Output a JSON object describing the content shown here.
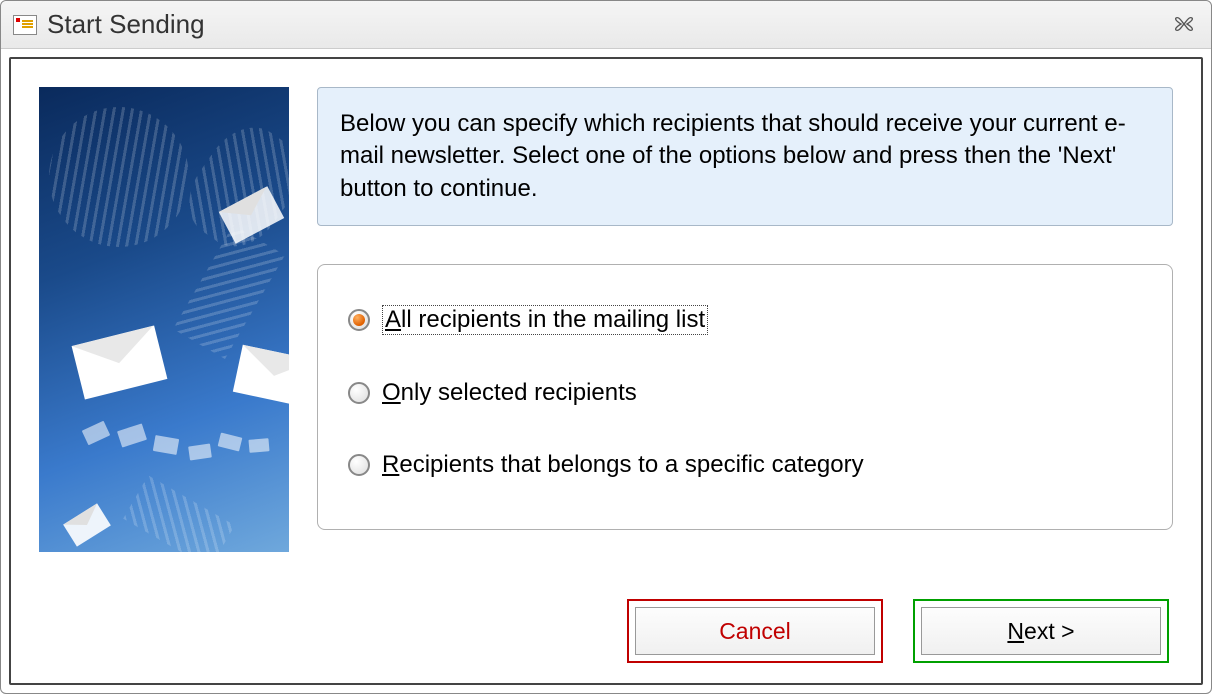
{
  "window": {
    "title": "Start Sending"
  },
  "info": {
    "text": "Below you can specify which recipients that should receive your current e-mail newsletter. Select one of the options below and press then the 'Next' button to continue."
  },
  "options": [
    {
      "label": "All recipients in the mailing list",
      "checked": true,
      "focused": true
    },
    {
      "label": "Only selected recipients",
      "checked": false,
      "focused": false
    },
    {
      "label": "Recipients that belongs to a specific category",
      "checked": false,
      "focused": false
    }
  ],
  "buttons": {
    "cancel": "Cancel",
    "next_prefix": "N",
    "next_rest": "ext >"
  }
}
